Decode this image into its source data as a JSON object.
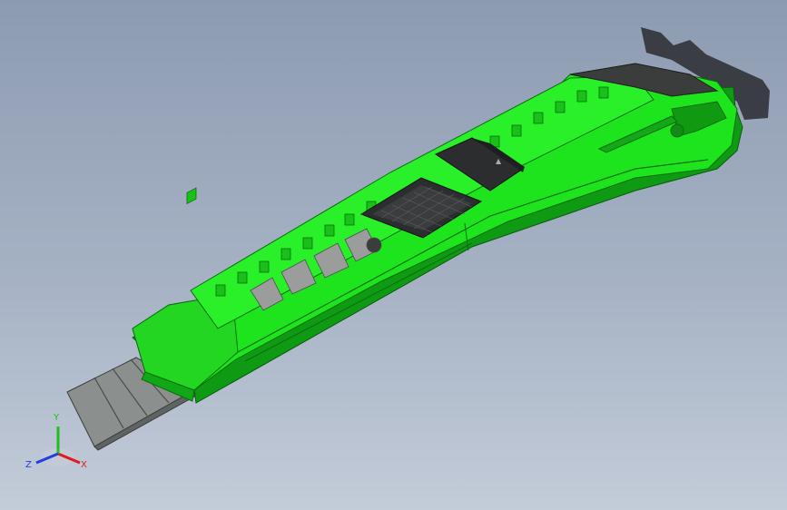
{
  "viewport": {
    "background_top": "#8d9bb2",
    "background_bottom": "#c3ccd9"
  },
  "model": {
    "body_color": "#1ee41e",
    "body_dark": "#0e9a12",
    "blade_color": "#8b8f8e",
    "slider_color": "#2b2d2e"
  },
  "triad": {
    "x_label": "X",
    "y_label": "Y",
    "z_label": "Z",
    "x_color": "#e01b1b",
    "y_color": "#1ec01e",
    "z_color": "#1f3fe0"
  }
}
